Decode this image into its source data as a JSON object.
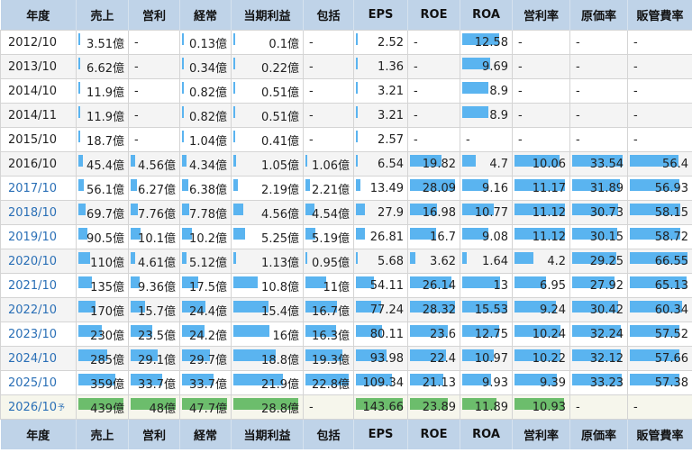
{
  "headers": [
    "年度",
    "売上",
    "営利",
    "経常",
    "当期利益",
    "包括",
    "EPS",
    "ROE",
    "ROA",
    "営利率",
    "原価率",
    "販管費率"
  ],
  "forecast_mark": "予",
  "rows": [
    {
      "year": "2012/10",
      "link": false,
      "cells": [
        "3.51億",
        "-",
        "0.13億",
        "0.1億",
        "-",
        "2.52",
        "-",
        "12.58",
        "-",
        "-",
        "-"
      ]
    },
    {
      "year": "2013/10",
      "link": false,
      "cells": [
        "6.62億",
        "-",
        "0.34億",
        "0.22億",
        "-",
        "1.36",
        "-",
        "9.69",
        "-",
        "-",
        "-"
      ]
    },
    {
      "year": "2014/10",
      "link": false,
      "cells": [
        "11.9億",
        "-",
        "0.82億",
        "0.51億",
        "-",
        "3.21",
        "-",
        "8.9",
        "-",
        "-",
        "-"
      ]
    },
    {
      "year": "2014/11",
      "link": false,
      "cells": [
        "11.9億",
        "-",
        "0.82億",
        "0.51億",
        "-",
        "3.21",
        "-",
        "8.9",
        "-",
        "-",
        "-"
      ]
    },
    {
      "year": "2015/10",
      "link": false,
      "cells": [
        "18.7億",
        "-",
        "1.04億",
        "0.41億",
        "-",
        "2.57",
        "-",
        "-",
        "-",
        "-",
        "-"
      ]
    },
    {
      "year": "2016/10",
      "link": false,
      "cells": [
        "45.4億",
        "4.56億",
        "4.34億",
        "1.05億",
        "1.06億",
        "6.54",
        "19.82",
        "4.7",
        "10.06",
        "33.54",
        "56.4"
      ]
    },
    {
      "year": "2017/10",
      "link": true,
      "cells": [
        "56.1億",
        "6.27億",
        "6.38億",
        "2.19億",
        "2.21億",
        "13.49",
        "28.09",
        "9.16",
        "11.17",
        "31.89",
        "56.93"
      ]
    },
    {
      "year": "2018/10",
      "link": true,
      "cells": [
        "69.7億",
        "7.76億",
        "7.78億",
        "4.56億",
        "4.54億",
        "27.9",
        "16.98",
        "10.77",
        "11.12",
        "30.73",
        "58.15"
      ]
    },
    {
      "year": "2019/10",
      "link": true,
      "cells": [
        "90.5億",
        "10.1億",
        "10.2億",
        "5.25億",
        "5.19億",
        "26.81",
        "16.7",
        "9.08",
        "11.12",
        "30.15",
        "58.72"
      ]
    },
    {
      "year": "2020/10",
      "link": true,
      "cells": [
        "110億",
        "4.61億",
        "5.12億",
        "1.13億",
        "0.95億",
        "5.68",
        "3.62",
        "1.64",
        "4.2",
        "29.25",
        "66.55"
      ]
    },
    {
      "year": "2021/10",
      "link": true,
      "cells": [
        "135億",
        "9.36億",
        "17.5億",
        "10.8億",
        "11億",
        "54.11",
        "26.14",
        "13",
        "6.95",
        "27.92",
        "65.13"
      ]
    },
    {
      "year": "2022/10",
      "link": true,
      "cells": [
        "170億",
        "15.7億",
        "24.4億",
        "15.4億",
        "16.7億",
        "77.24",
        "28.32",
        "15.53",
        "9.24",
        "30.42",
        "60.34"
      ]
    },
    {
      "year": "2023/10",
      "link": true,
      "cells": [
        "230億",
        "23.5億",
        "24.2億",
        "16億",
        "16.3億",
        "80.11",
        "23.6",
        "12.75",
        "10.24",
        "32.24",
        "57.52"
      ]
    },
    {
      "year": "2024/10",
      "link": true,
      "cells": [
        "285億",
        "29.1億",
        "29.7億",
        "18.8億",
        "19.3億",
        "93.98",
        "22.4",
        "10.97",
        "10.22",
        "32.12",
        "57.66"
      ]
    },
    {
      "year": "2025/10",
      "link": true,
      "cells": [
        "359億",
        "33.7億",
        "33.7億",
        "21.9億",
        "22.8億",
        "109.34",
        "21.13",
        "9.93",
        "9.39",
        "33.23",
        "57.38"
      ]
    },
    {
      "year": "2026/10",
      "link": true,
      "forecast": true,
      "cells": [
        "439億",
        "48億",
        "47.7億",
        "28.8億",
        "-",
        "143.66",
        "23.89",
        "11.89",
        "10.93",
        "-",
        "-"
      ]
    }
  ]
}
